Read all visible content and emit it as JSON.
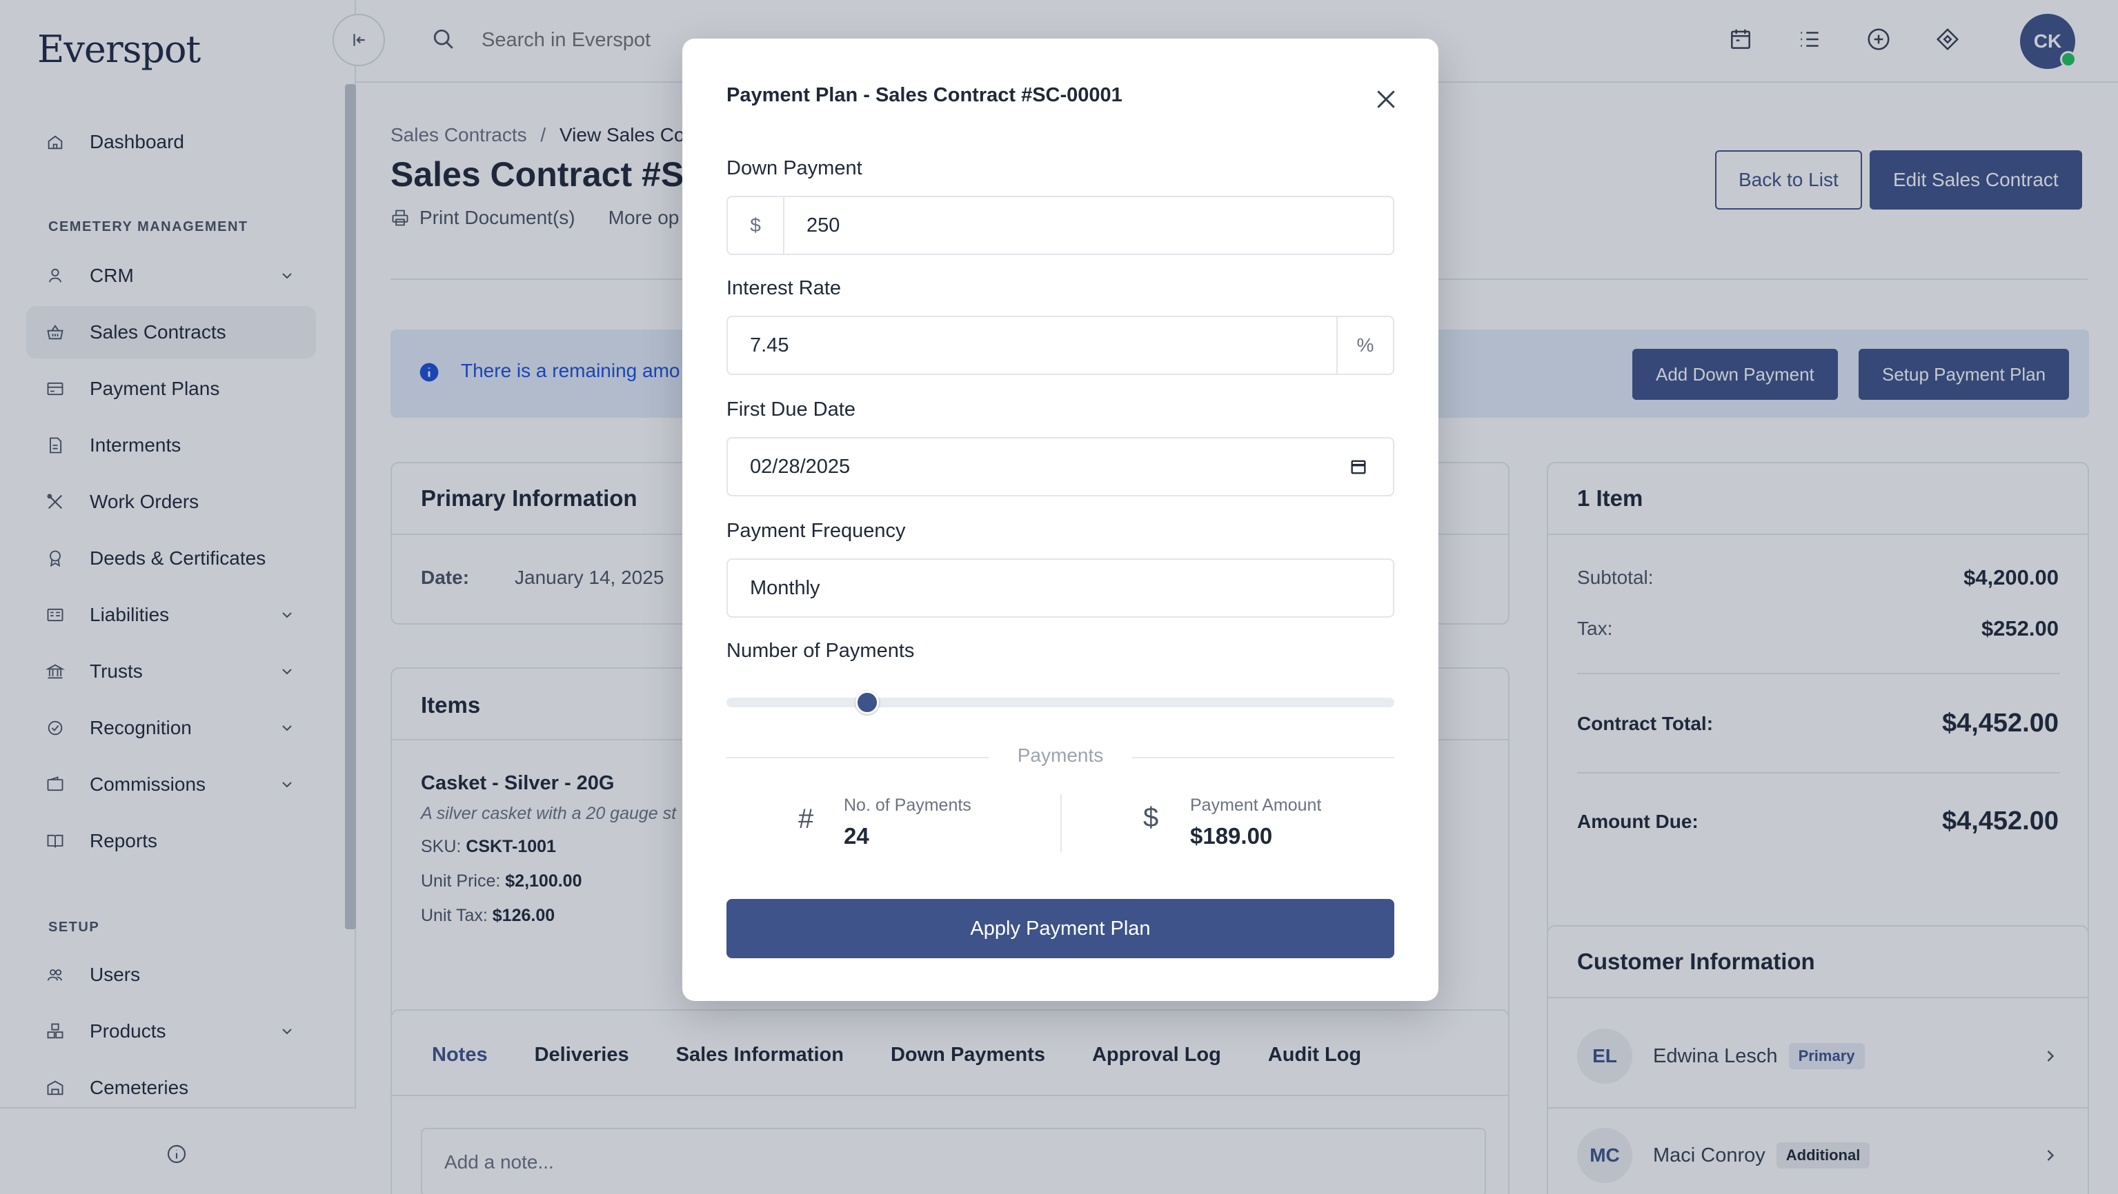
{
  "app": {
    "logo": "Everspot"
  },
  "topbar": {
    "search_placeholder": "Search in Everspot",
    "user_initials": "CK"
  },
  "sidebar": {
    "items": [
      {
        "label": "Dashboard"
      },
      {
        "label": "CRM"
      },
      {
        "label": "Sales Contracts"
      },
      {
        "label": "Payment Plans"
      },
      {
        "label": "Interments"
      },
      {
        "label": "Work Orders"
      },
      {
        "label": "Deeds & Certificates"
      },
      {
        "label": "Liabilities"
      },
      {
        "label": "Trusts"
      },
      {
        "label": "Recognition"
      },
      {
        "label": "Commissions"
      },
      {
        "label": "Reports"
      },
      {
        "label": "Users"
      },
      {
        "label": "Products"
      },
      {
        "label": "Cemeteries"
      }
    ],
    "sections": {
      "cemetery": "CEMETERY MANAGEMENT",
      "setup": "SETUP"
    }
  },
  "page": {
    "breadcrumb_parent": "Sales Contracts",
    "breadcrumb_sep": "/",
    "breadcrumb_current": "View Sales Co",
    "title": "Sales Contract #SC",
    "print_label": "Print Document(s)",
    "more_label": "More op",
    "back_button": "Back to List",
    "edit_button": "Edit Sales Contract",
    "alert_text": "There is a remaining amo",
    "add_down_payment": "Add Down Payment",
    "setup_payment_plan": "Setup Payment Plan"
  },
  "primary_info": {
    "title": "Primary Information",
    "date_label": "Date:",
    "date_value": "January 14, 2025"
  },
  "items_card": {
    "title": "Items",
    "item_name": "Casket - Silver - 20G",
    "item_desc": "A silver casket with a 20 gauge st",
    "sku_label": "SKU:",
    "sku_value": "CSKT-1001",
    "unit_price_label": "Unit Price:",
    "unit_price_value": "$2,100.00",
    "unit_tax_label": "Unit Tax:",
    "unit_tax_value": "$126.00"
  },
  "tabs": [
    "Notes",
    "Deliveries",
    "Sales Information",
    "Down Payments",
    "Approval Log",
    "Audit Log"
  ],
  "note_placeholder": "Add a note...",
  "summary": {
    "title": "1 Item",
    "subtotal_label": "Subtotal:",
    "subtotal_value": "$4,200.00",
    "tax_label": "Tax:",
    "tax_value": "$252.00",
    "contract_total_label": "Contract Total:",
    "contract_total_value": "$4,452.00",
    "amount_due_label": "Amount Due:",
    "amount_due_value": "$4,452.00"
  },
  "customers": {
    "title": "Customer Information",
    "list": [
      {
        "initials": "EL",
        "name": "Edwina Lesch",
        "badge": "Primary"
      },
      {
        "initials": "MC",
        "name": "Maci Conroy",
        "badge": "Additional"
      }
    ]
  },
  "modal": {
    "title": "Payment Plan - Sales Contract #SC-00001",
    "down_payment_label": "Down Payment",
    "down_payment_prefix": "$",
    "down_payment_value": "250",
    "interest_rate_label": "Interest Rate",
    "interest_rate_value": "7.45",
    "interest_rate_suffix": "%",
    "first_due_label": "First Due Date",
    "first_due_value": "02/28/2025",
    "frequency_label": "Payment Frequency",
    "frequency_value": "Monthly",
    "num_payments_label": "Number of Payments",
    "slider_fraction": 0.2,
    "payments_heading": "Payments",
    "no_payments_label": "No. of Payments",
    "no_payments_value": "24",
    "no_payments_icon": "#",
    "payment_amount_label": "Payment Amount",
    "payment_amount_value": "$189.00",
    "payment_amount_icon": "$",
    "apply_button": "Apply Payment Plan"
  },
  "colors": {
    "accent": "#3e5389",
    "alert_bg": "#e3ecf9",
    "alert_text": "#1d4ed8"
  }
}
